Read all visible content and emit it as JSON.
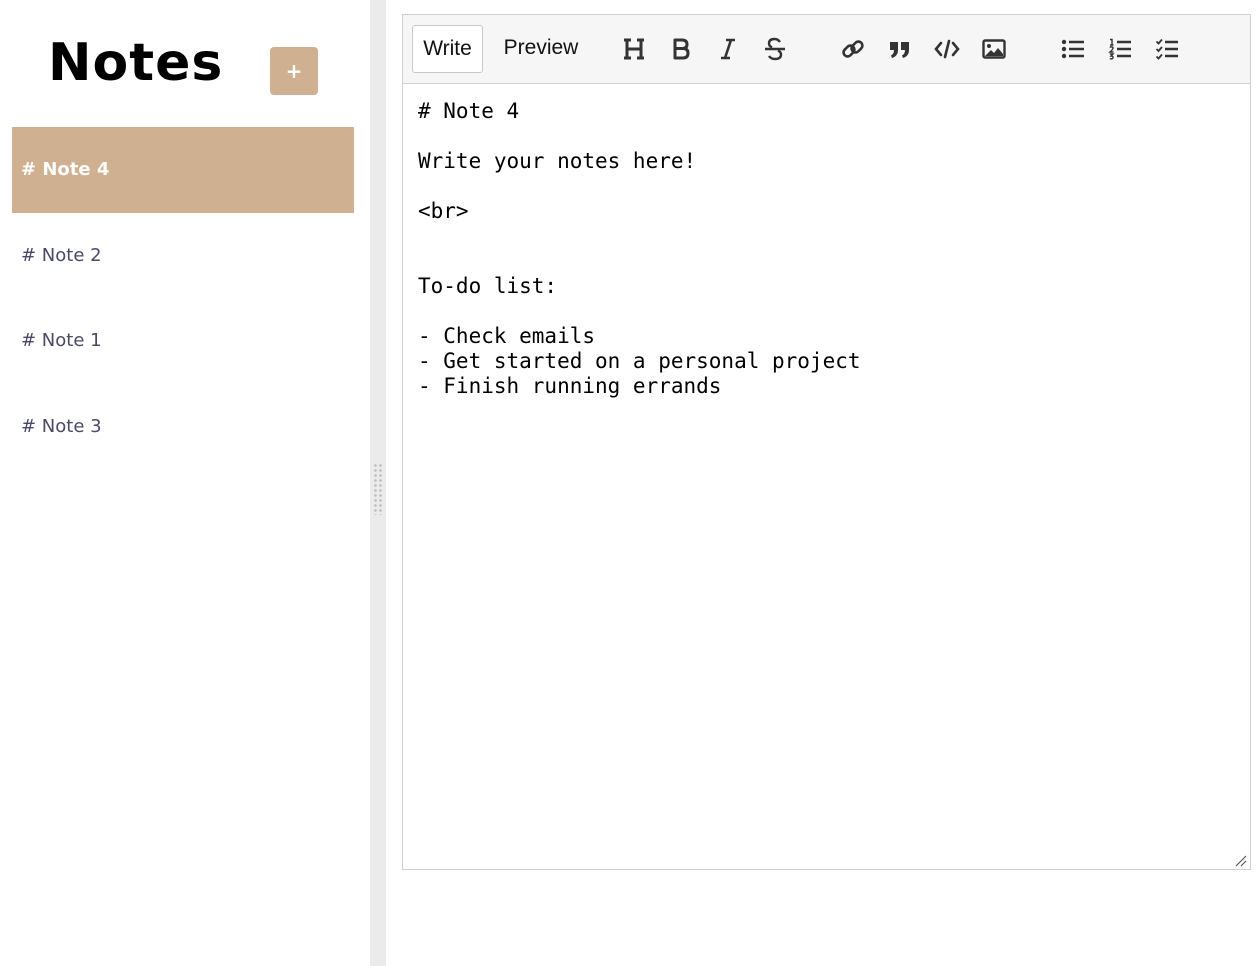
{
  "sidebar": {
    "title": "Notes",
    "add_label": "+",
    "notes": [
      {
        "label": "# Note 4",
        "active": true
      },
      {
        "label": "# Note 2",
        "active": false
      },
      {
        "label": "# Note 1",
        "active": false
      },
      {
        "label": "# Note 3",
        "active": false
      }
    ]
  },
  "editor": {
    "tabs": {
      "write": "Write",
      "preview": "Preview"
    },
    "toolbar_icons": [
      "heading-icon",
      "bold-icon",
      "italic-icon",
      "strikethrough-icon",
      "link-icon",
      "quote-icon",
      "code-icon",
      "image-icon",
      "unordered-list-icon",
      "ordered-list-icon",
      "checked-list-icon"
    ],
    "content": "# Note 4\n\nWrite your notes here!\n\n<br>\n\n\nTo-do list:\n\n- Check emails\n- Get started on a personal project\n- Finish running errands"
  },
  "colors": {
    "accent": "#cfb192",
    "note_text": "#4a4a68",
    "splitter": "#ebebeb",
    "toolbar_bg": "#f6f6f6"
  }
}
